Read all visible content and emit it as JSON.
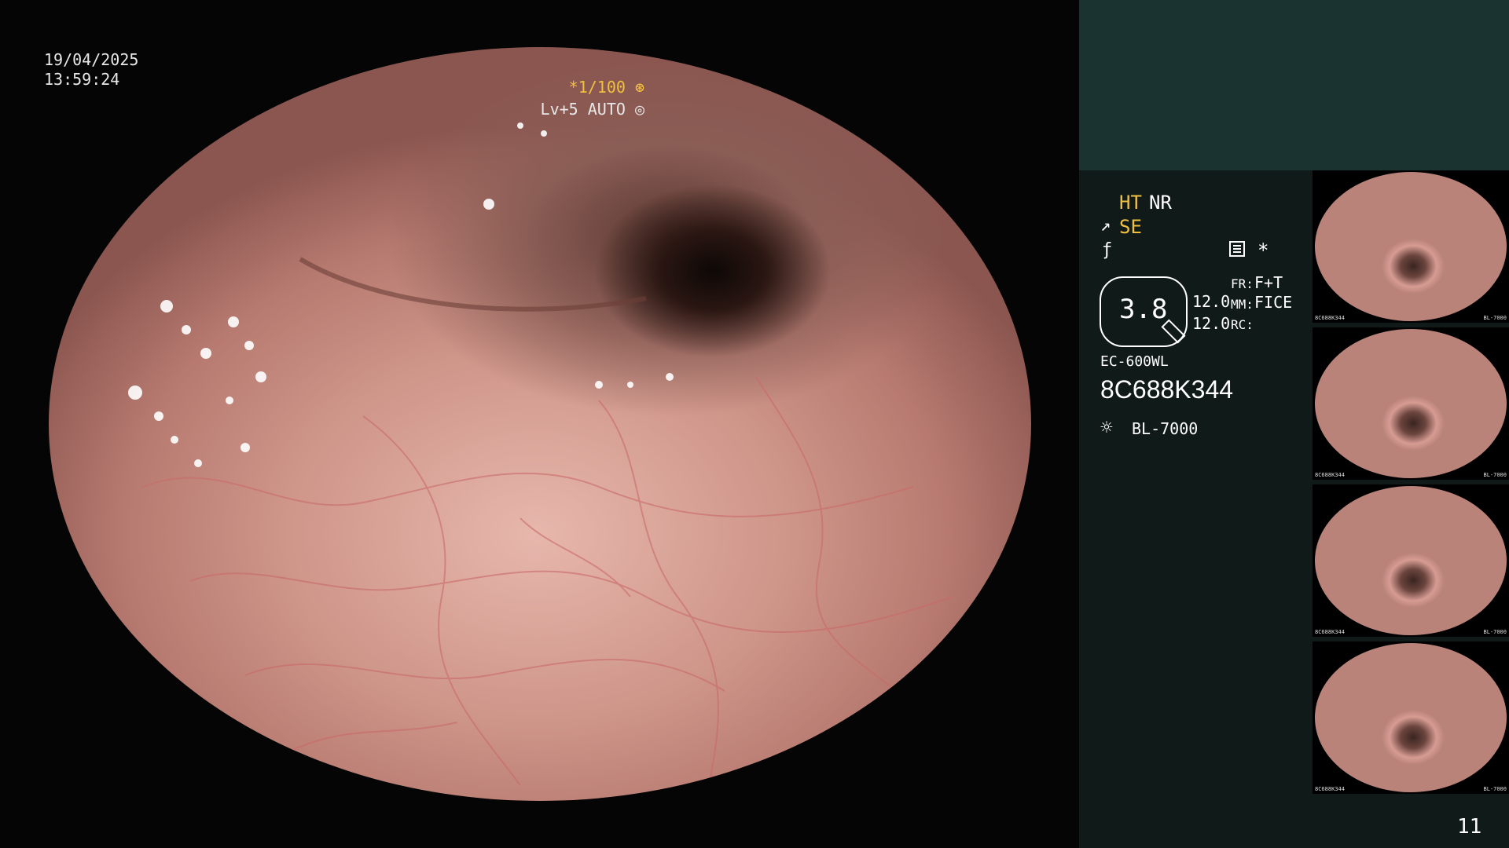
{
  "overlay": {
    "date": "19/04/2025",
    "time": "13:59:24",
    "exposure": "*1/100",
    "level": "Lv+5 AUTO"
  },
  "panel": {
    "ht": "HT",
    "nr": "NR",
    "se": "SE",
    "dial_value": "3.8",
    "value_a": "12.0",
    "value_b": "12.0",
    "fr_label": "FR:",
    "mm_label": "MM:",
    "rc_label": "RC:",
    "fr_value": "F+T",
    "mm_value": "FICE",
    "model": "EC-600WL",
    "serial": "8C688K344",
    "light_source": "BL-7000",
    "icons": [
      "scope-angle-icon",
      "enhance-icon",
      "menu-icon",
      "asterisk-icon",
      "light-icon"
    ]
  },
  "thumbnails": [
    {
      "serial": "8C688K344",
      "light": "BL-7000"
    },
    {
      "serial": "8C688K344",
      "light": "BL-7000"
    },
    {
      "serial": "8C688K344",
      "light": "BL-7000"
    },
    {
      "serial": "8C688K344",
      "light": "BL-7000"
    }
  ],
  "page_number": "11"
}
